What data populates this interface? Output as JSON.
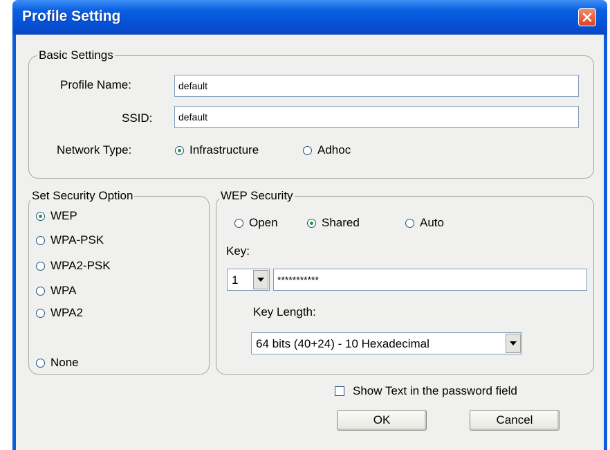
{
  "window": {
    "title": "Profile Setting"
  },
  "basic": {
    "legend": "Basic Settings",
    "profile_name_label": "Profile Name:",
    "profile_name_value": "default",
    "ssid_label": "SSID:",
    "ssid_value": "default",
    "network_type_label": "Network Type:",
    "network_types": [
      "Infrastructure",
      "Adhoc"
    ],
    "network_type_selected": "Infrastructure"
  },
  "security_option": {
    "legend": "Set Security Option",
    "options": [
      "WEP",
      "WPA-PSK",
      "WPA2-PSK",
      "WPA",
      "WPA2",
      "None"
    ],
    "selected": "WEP"
  },
  "wep": {
    "legend": "WEP Security",
    "auth_modes": [
      "Open",
      "Shared",
      "Auto"
    ],
    "auth_selected": "Shared",
    "key_label": "Key:",
    "key_index": "1",
    "key_value": "***********",
    "key_length_label": "Key Length:",
    "key_length_value": "64 bits (40+24) - 10 Hexadecimal"
  },
  "footer": {
    "show_text_label": "Show Text in the password field",
    "ok_label": "OK",
    "cancel_label": "Cancel"
  }
}
